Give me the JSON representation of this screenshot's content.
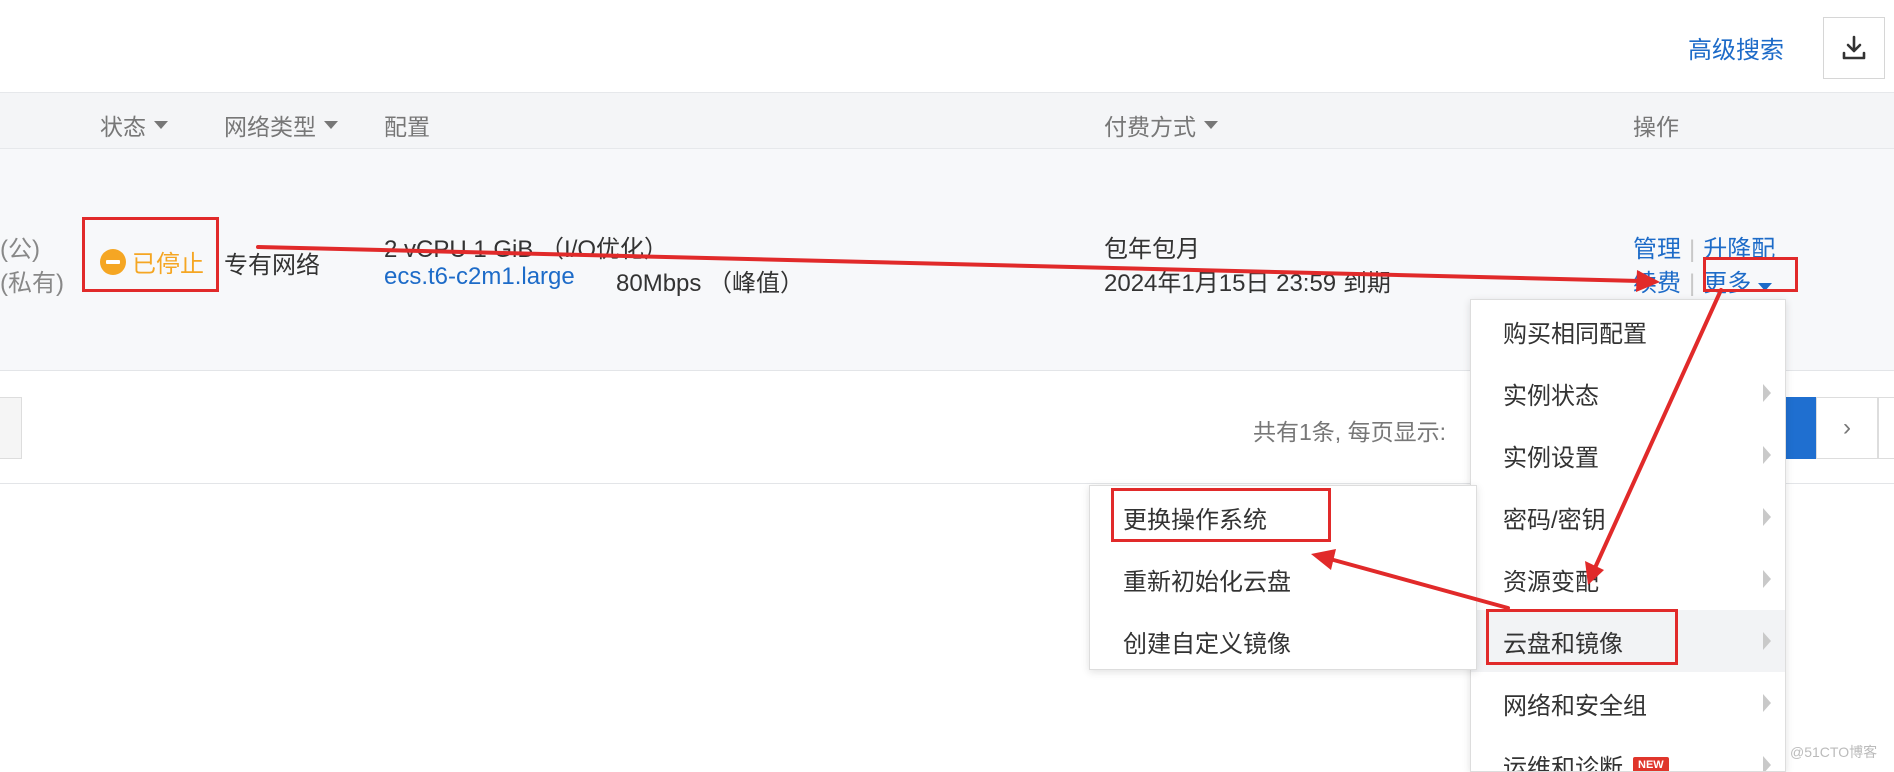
{
  "header": {
    "advanced_search": "高级搜索",
    "download_icon": "download-icon"
  },
  "table": {
    "columns": {
      "status": "状态",
      "network_type": "网络类型",
      "config": "配置",
      "billing": "付费方式",
      "actions": "操作"
    },
    "row": {
      "ip_public_suffix": "(公)",
      "ip_private_suffix": "(私有)",
      "status": "已停止",
      "network_type": "专有网络",
      "config_line1": "2 vCPU 1 GiB （I/O优化）",
      "instance_type": "ecs.t6-c2m1.large",
      "bandwidth": "80Mbps （峰值）",
      "billing_type": "包年包月",
      "expiry": "2024年1月15日 23:59 到期",
      "action_manage": "管理",
      "action_upgrade": "升降配",
      "action_renew": "续费",
      "action_more": "更多"
    }
  },
  "pagination": {
    "total_text": "共有1条, 每页显示:",
    "next": "›"
  },
  "more_menu": {
    "items": [
      {
        "label": "购买相同配置",
        "has_submenu": false
      },
      {
        "label": "实例状态",
        "has_submenu": true
      },
      {
        "label": "实例设置",
        "has_submenu": true
      },
      {
        "label": "密码/密钥",
        "has_submenu": true
      },
      {
        "label": "资源变配",
        "has_submenu": true
      },
      {
        "label": "云盘和镜像",
        "has_submenu": true,
        "active": true
      },
      {
        "label": "网络和安全组",
        "has_submenu": true
      },
      {
        "label": "运维和诊断",
        "has_submenu": true,
        "badge": "NEW"
      }
    ]
  },
  "disk_image_submenu": {
    "items": [
      {
        "label": "更换操作系统"
      },
      {
        "label": "重新初始化云盘"
      },
      {
        "label": "创建自定义镜像"
      }
    ]
  },
  "watermark": "@51CTO博客",
  "colors": {
    "accent": "#1d6bc8",
    "stopped": "#f5a623",
    "annotation": "#e12a2a"
  }
}
